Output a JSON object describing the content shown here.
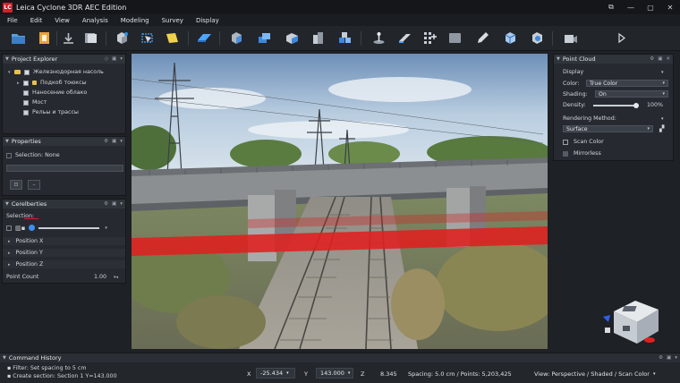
{
  "app": {
    "logo_text": "LC",
    "title": "Leica Cyclone 3DR AEC Edition"
  },
  "window_controls": [
    "⧉",
    "—",
    "▢",
    "✕"
  ],
  "menu": [
    "File",
    "Edit",
    "View",
    "Analysis",
    "Modeling",
    "Survey",
    "Display"
  ],
  "toolbar_icons": [
    "open-folder-icon",
    "import-icon",
    "download-icon",
    "save-icon",
    "select-cube-icon",
    "bounding-box-icon",
    "sticky-note-icon",
    "plane-icon",
    "cube-view-icon",
    "box-stack-icon",
    "box-side-icon",
    "block-icon",
    "boxes-icon",
    "survey-point-icon",
    "slice-icon",
    "grid-icon",
    "solid-box-icon",
    "pencil-icon",
    "mesh-cube-icon",
    "settings-cube-icon",
    "camera-cube-icon",
    "play-icon"
  ],
  "project_explorer": {
    "title": "Project Explorer",
    "root": "Железнодорная насоль",
    "items": [
      {
        "label": "Подкоб тоюксы",
        "checked": true
      },
      {
        "label": "Наносение облако",
        "checked": false
      },
      {
        "label": "Мост",
        "checked": false
      },
      {
        "label": "Рельы и трассы",
        "checked": false
      }
    ]
  },
  "properties": {
    "title": "Properties",
    "selection": "Selection: None"
  },
  "coordinates": {
    "title": "Cerelberties",
    "selection_label": "Selection:",
    "rows": [
      "Position X",
      "Position Y",
      "Position Z"
    ],
    "point_count_label": "Point Count",
    "point_count_value": "1.00"
  },
  "point_cloud": {
    "title": "Point Cloud",
    "display_label": "Display",
    "color_label": "Color:",
    "color_value": "True Color",
    "shading_label": "Shading:",
    "shading_value": "On",
    "density_label": "Density:",
    "density_value": "100%",
    "density_fraction": 1.0,
    "rendering_label": "Rendering Method:",
    "rendering_value": "Surface",
    "scan_color_label": "Scan Color",
    "mirrorless_label": "Mirrorless"
  },
  "command_history": {
    "title": "Command History",
    "lines": [
      "Filter: Set spacing to 5 cm",
      "Create section: Section 1 Y=143.000"
    ]
  },
  "status": {
    "x_label": "X",
    "x_value": "-25.434",
    "y_label": "Y",
    "y_value": "143.000",
    "z_label": "Z",
    "z_value": "8.345",
    "spacing": "Spacing:   5.0 cm / Points: 5,203,425",
    "view": "View: Perspective / Shaded / Scan Color"
  },
  "colors": {
    "accent": "#d2202a",
    "section_band": "#e01f1f",
    "panel": "#262a30"
  }
}
